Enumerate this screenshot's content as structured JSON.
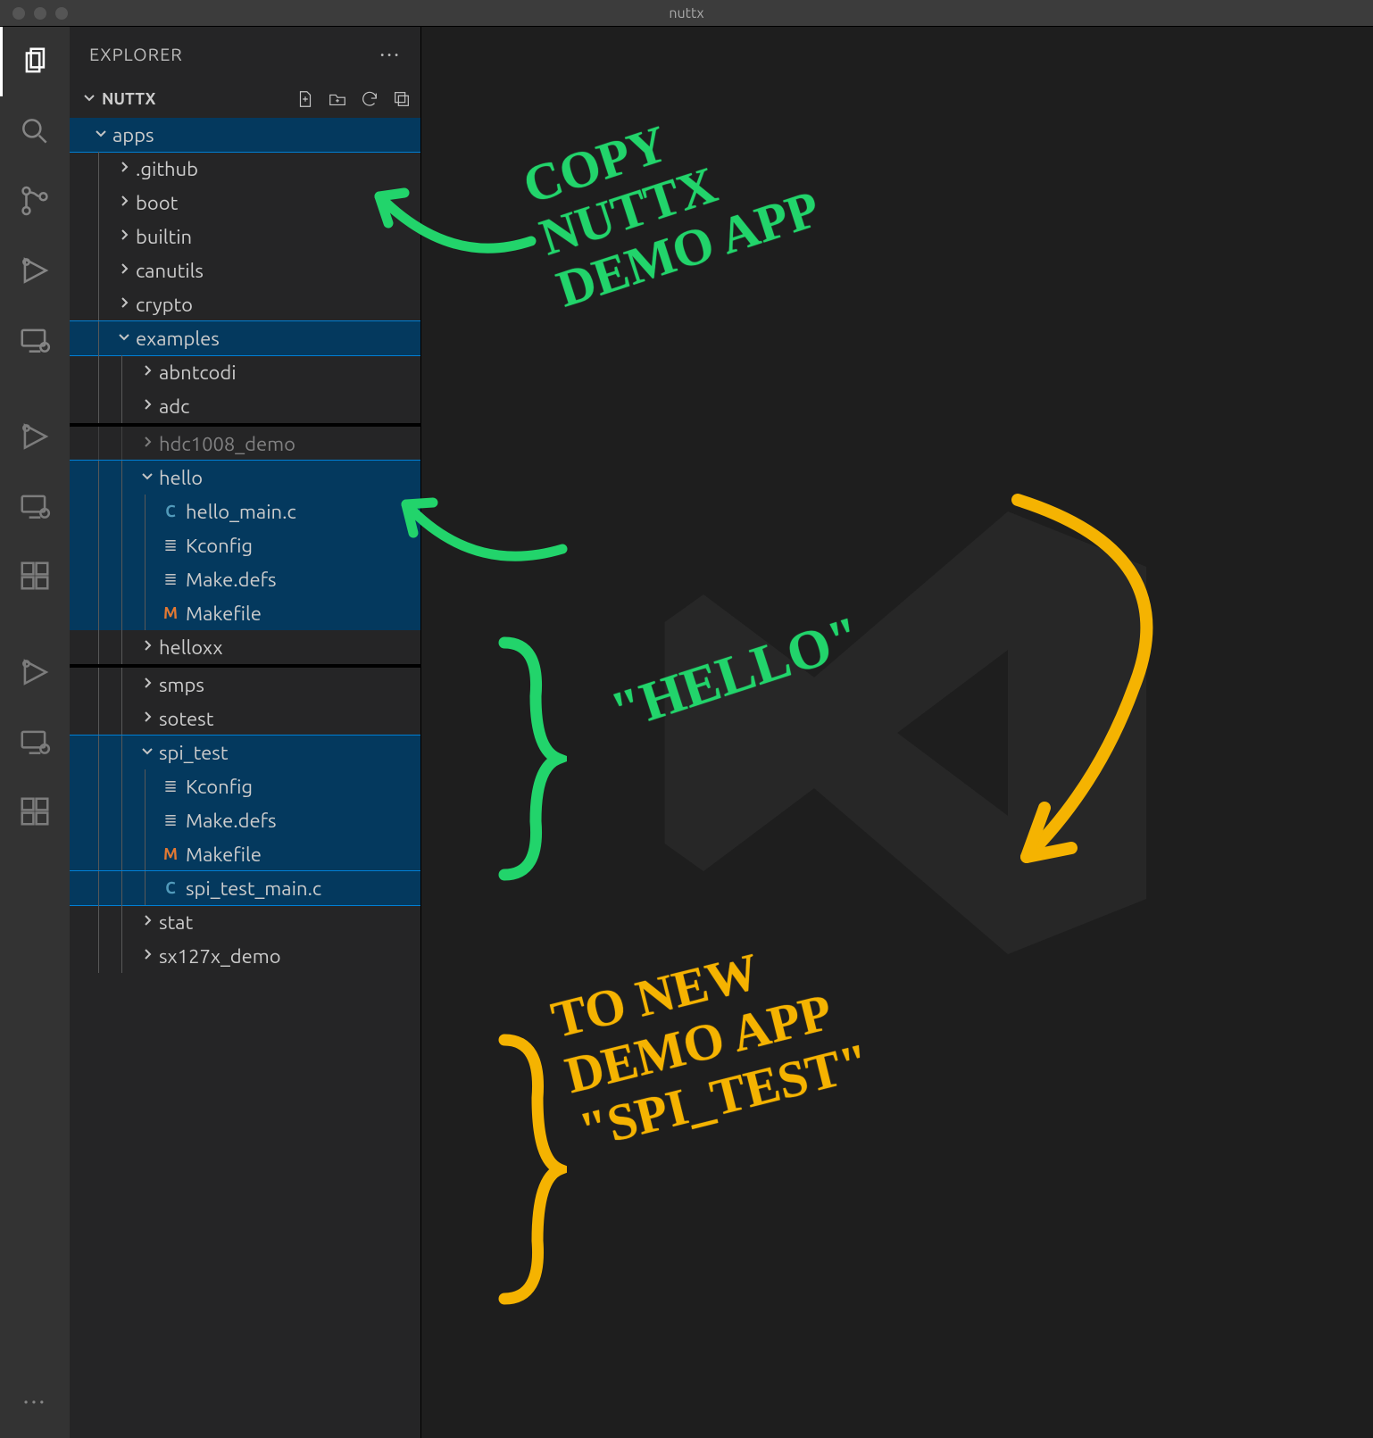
{
  "window": {
    "title": "nuttx"
  },
  "explorer": {
    "title": "EXPLORER",
    "root": "NUTTX"
  },
  "annotations": {
    "copy": "COPY\nNUTTX\nDEMO APP",
    "hello": "\"HELLO\"",
    "to_new": "TO NEW\nDEMO APP\n\"SPI_TEST\""
  },
  "tree": {
    "seg1": [
      {
        "type": "folder",
        "name": "apps",
        "open": true,
        "depth": 0,
        "selected": true
      },
      {
        "type": "folder",
        "name": ".github",
        "open": false,
        "depth": 1
      },
      {
        "type": "folder",
        "name": "boot",
        "open": false,
        "depth": 1
      },
      {
        "type": "folder",
        "name": "builtin",
        "open": false,
        "depth": 1
      },
      {
        "type": "folder",
        "name": "canutils",
        "open": false,
        "depth": 1
      },
      {
        "type": "folder",
        "name": "crypto",
        "open": false,
        "depth": 1
      },
      {
        "type": "folder",
        "name": "examples",
        "open": true,
        "depth": 1,
        "selected": true
      },
      {
        "type": "folder",
        "name": "abntcodi",
        "open": false,
        "depth": 2
      },
      {
        "type": "folder",
        "name": "adc",
        "open": false,
        "depth": 2
      }
    ],
    "seg2": [
      {
        "type": "folder",
        "name": "hdc1008_demo",
        "open": false,
        "depth": 2,
        "dim": true
      },
      {
        "type": "folder",
        "name": "hello",
        "open": true,
        "depth": 2,
        "selected": true
      },
      {
        "type": "file",
        "name": "hello_main.c",
        "icon": "C",
        "iconClass": "ic-c",
        "depth": 3,
        "range": true
      },
      {
        "type": "file",
        "name": "Kconfig",
        "icon": "≣",
        "iconClass": "ic-lines",
        "depth": 3,
        "range": true
      },
      {
        "type": "file",
        "name": "Make.defs",
        "icon": "≣",
        "iconClass": "ic-lines",
        "depth": 3,
        "range": true
      },
      {
        "type": "file",
        "name": "Makefile",
        "icon": "M",
        "iconClass": "ic-m",
        "depth": 3,
        "range": true
      },
      {
        "type": "folder",
        "name": "helloxx",
        "open": false,
        "depth": 2
      }
    ],
    "seg3": [
      {
        "type": "folder",
        "name": "smps",
        "open": false,
        "depth": 2
      },
      {
        "type": "folder",
        "name": "sotest",
        "open": false,
        "depth": 2
      },
      {
        "type": "folder",
        "name": "spi_test",
        "open": true,
        "depth": 2,
        "selected": true
      },
      {
        "type": "file",
        "name": "Kconfig",
        "icon": "≣",
        "iconClass": "ic-lines",
        "depth": 3,
        "range": true
      },
      {
        "type": "file",
        "name": "Make.defs",
        "icon": "≣",
        "iconClass": "ic-lines",
        "depth": 3,
        "range": true
      },
      {
        "type": "file",
        "name": "Makefile",
        "icon": "M",
        "iconClass": "ic-m",
        "depth": 3,
        "range": true
      },
      {
        "type": "file",
        "name": "spi_test_main.c",
        "icon": "C",
        "iconClass": "ic-c",
        "depth": 3,
        "range": true,
        "selected": true
      },
      {
        "type": "folder",
        "name": "stat",
        "open": false,
        "depth": 2
      },
      {
        "type": "folder",
        "name": "sx127x_demo",
        "open": false,
        "depth": 2
      }
    ]
  }
}
